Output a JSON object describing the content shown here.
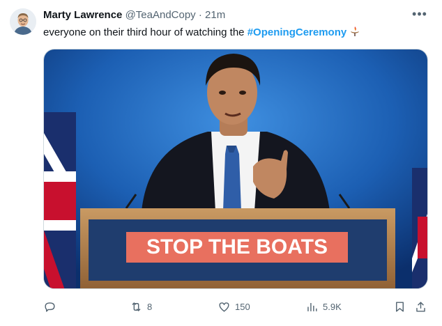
{
  "author": {
    "name": "Marty Lawrence",
    "handle": "@TeaAndCopy",
    "separator": "·",
    "time": "21m"
  },
  "tweet": {
    "text_before": "everyone on their third hour of watching the ",
    "hashtag": "#OpeningCeremony",
    "emoji_icon": "olympic-torch-icon"
  },
  "media": {
    "podium_sign": "STOP THE BOATS"
  },
  "actions": {
    "reply_count": "",
    "repost_count": "8",
    "like_count": "150",
    "views_count": "5.9K"
  },
  "colors": {
    "link_blue": "#1d9bf0",
    "muted": "#536471",
    "backdrop_blue": "#1c5fb3",
    "sign_red": "#e8705f"
  }
}
